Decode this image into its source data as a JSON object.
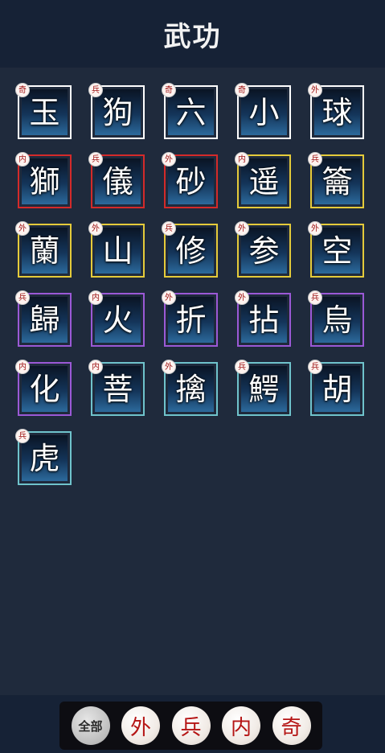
{
  "header": {
    "title": "武功"
  },
  "tiles": [
    {
      "char": "玉",
      "tag": "奇",
      "border": "#ffffff"
    },
    {
      "char": "狗",
      "tag": "兵",
      "border": "#ffffff"
    },
    {
      "char": "六",
      "tag": "奇",
      "border": "#ffffff"
    },
    {
      "char": "小",
      "tag": "奇",
      "border": "#ffffff"
    },
    {
      "char": "球",
      "tag": "外",
      "border": "#ffffff"
    },
    {
      "char": "獅",
      "tag": "内",
      "border": "#d42a2a"
    },
    {
      "char": "儀",
      "tag": "兵",
      "border": "#d42a2a"
    },
    {
      "char": "砂",
      "tag": "外",
      "border": "#d42a2a"
    },
    {
      "char": "遥",
      "tag": "内",
      "border": "#e5cb3a"
    },
    {
      "char": "籥",
      "tag": "兵",
      "border": "#e5cb3a"
    },
    {
      "char": "蘭",
      "tag": "外",
      "border": "#e5cb3a"
    },
    {
      "char": "山",
      "tag": "外",
      "border": "#e5cb3a"
    },
    {
      "char": "修",
      "tag": "兵",
      "border": "#e5cb3a"
    },
    {
      "char": "参",
      "tag": "外",
      "border": "#e5cb3a"
    },
    {
      "char": "空",
      "tag": "外",
      "border": "#e5cb3a"
    },
    {
      "char": "歸",
      "tag": "兵",
      "border": "#9b59d6"
    },
    {
      "char": "火",
      "tag": "内",
      "border": "#9b59d6"
    },
    {
      "char": "折",
      "tag": "外",
      "border": "#9b59d6"
    },
    {
      "char": "拈",
      "tag": "外",
      "border": "#9b59d6"
    },
    {
      "char": "烏",
      "tag": "兵",
      "border": "#9b59d6"
    },
    {
      "char": "化",
      "tag": "内",
      "border": "#9b59d6"
    },
    {
      "char": "菩",
      "tag": "内",
      "border": "#6fc3cc"
    },
    {
      "char": "擒",
      "tag": "外",
      "border": "#6fc3cc"
    },
    {
      "char": "鰐",
      "tag": "兵",
      "border": "#6fc3cc"
    },
    {
      "char": "胡",
      "tag": "兵",
      "border": "#6fc3cc"
    },
    {
      "char": "虎",
      "tag": "兵",
      "border": "#6fc3cc"
    }
  ],
  "filters": [
    {
      "label": "全部",
      "active": true
    },
    {
      "label": "外",
      "active": false
    },
    {
      "label": "兵",
      "active": false
    },
    {
      "label": "内",
      "active": false
    },
    {
      "label": "奇",
      "active": false
    }
  ]
}
